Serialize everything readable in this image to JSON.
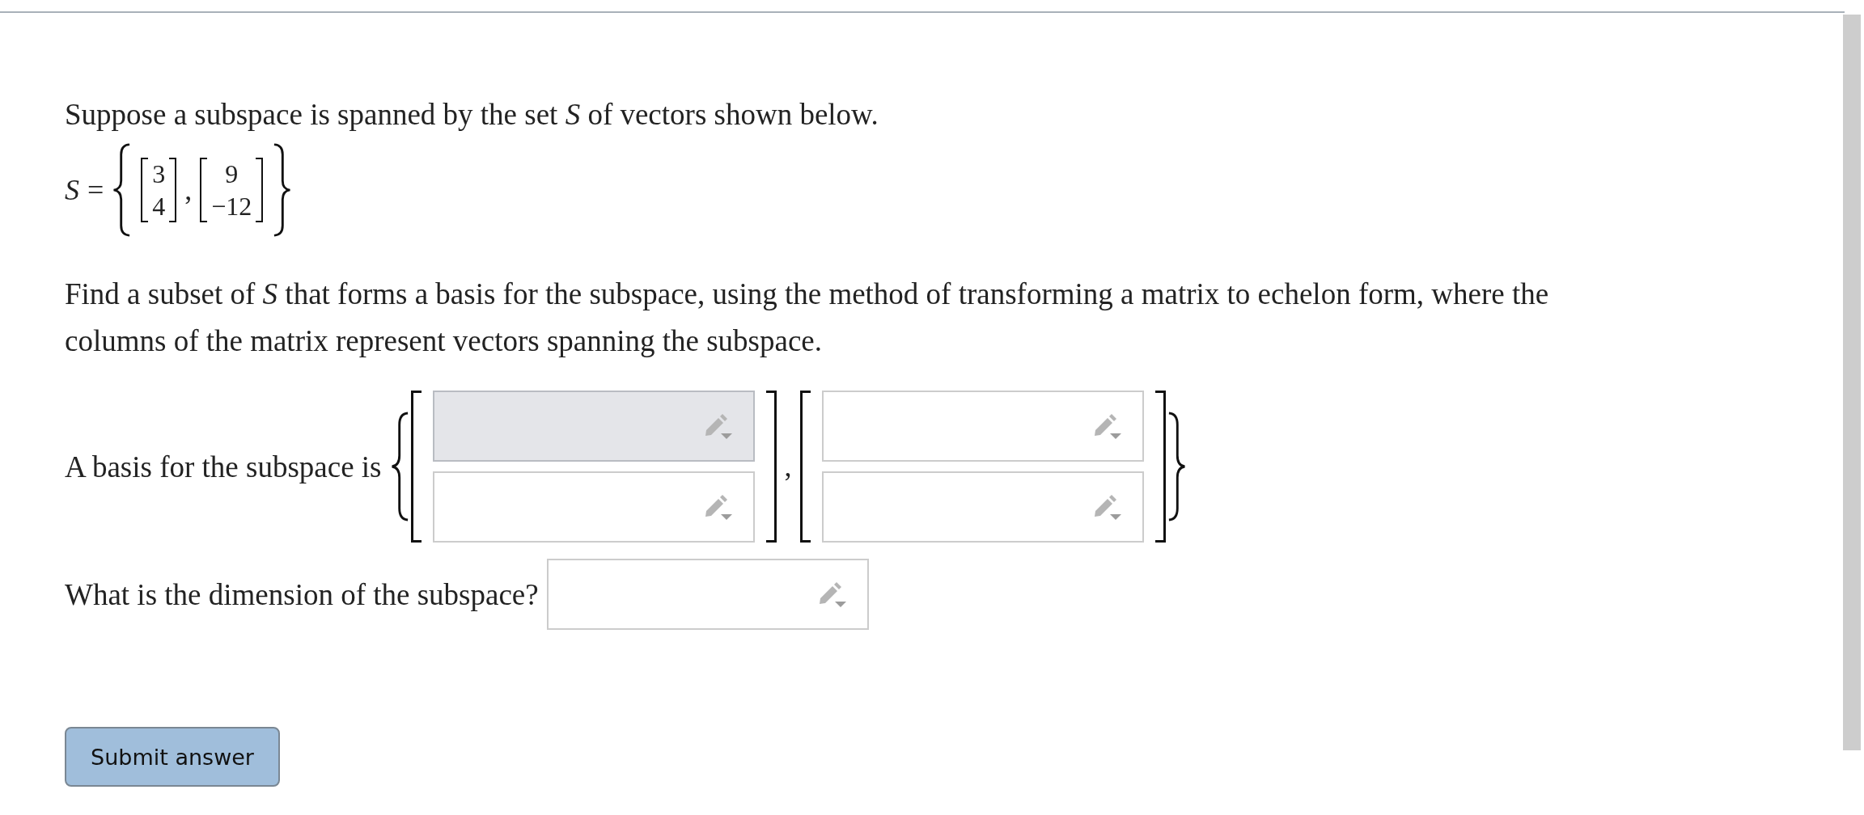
{
  "intro": "Suppose a subspace is spanned by the set *S* of vectors shown below.",
  "set": {
    "name": "S",
    "equals": "=",
    "separator": ",",
    "vectors": [
      [
        "3",
        "4"
      ],
      [
        "9",
        "−12"
      ]
    ]
  },
  "instruction": "Find a subset of *S* that forms a basis for the subspace, using the method of transforming a matrix to echelon form, where the columns of the matrix represent vectors spanning the subspace.",
  "basis": {
    "label": "A basis for the subspace is",
    "separator": ",",
    "vectors": [
      [
        {
          "active": true
        },
        {
          "active": false
        }
      ],
      [
        {
          "active": false
        },
        {
          "active": false
        }
      ]
    ]
  },
  "dimension": {
    "label": "What is the dimension of the subspace?",
    "field": {
      "active": false
    }
  },
  "submit": "Submit answer"
}
